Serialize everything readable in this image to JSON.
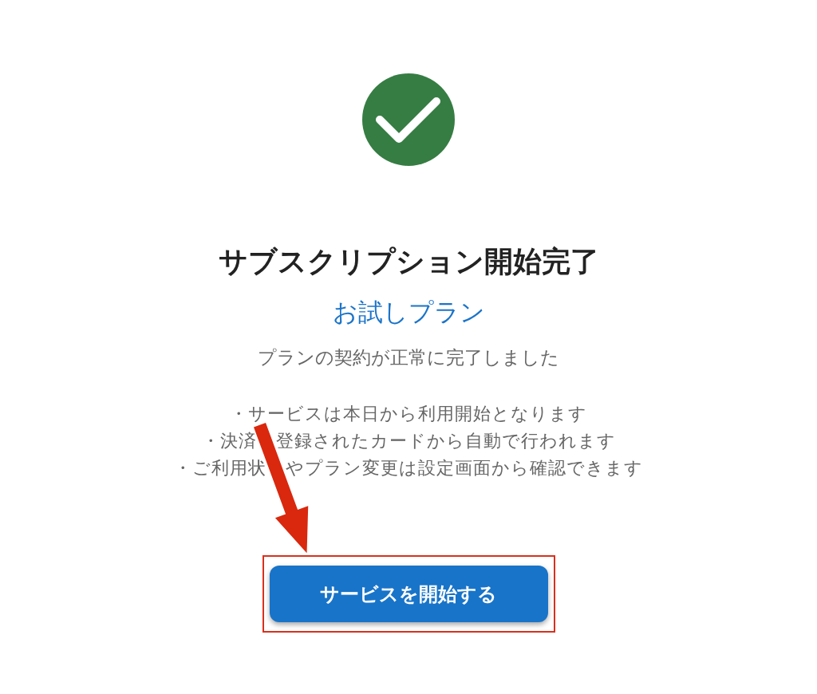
{
  "title": "サブスクリプション開始完了",
  "plan_name": "お試しプラン",
  "message": "プランの契約が正常に完了しました",
  "notes": [
    {
      "parts": [
        "・サービスは本日から利用開始となります"
      ]
    },
    {
      "parts": [
        "・決済",
        "登録されたカードから自動で行われます"
      ]
    },
    {
      "parts": [
        "・ご利用状",
        "やプラン変更は設定画面から確認できます"
      ]
    }
  ],
  "button": {
    "label": "サービスを開始する"
  }
}
